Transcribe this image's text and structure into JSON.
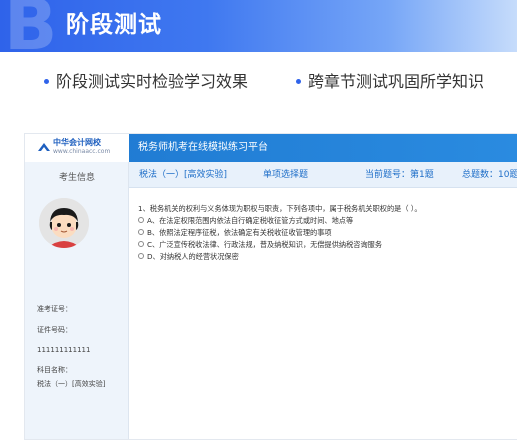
{
  "banner": {
    "letter": "B",
    "title": "阶段测试"
  },
  "features": [
    {
      "text": "阶段测试实时检验学习效果"
    },
    {
      "text": "跨章节测试巩固所学知识"
    }
  ],
  "app": {
    "logo": {
      "name_cn": "中华会计网校",
      "domain": "www.chinaacc.com"
    },
    "title": "税务师机考在线模拟练习平台",
    "sidebar": {
      "candidate_label": "考生信息",
      "exam_no_label": "准考证号：",
      "id_label": "证件号码：",
      "id_value": "111111111111",
      "subject_label": "科目名称：",
      "subject_value": "税法（一）[高效实验]"
    },
    "subheader": {
      "subject": "税法（一）[高效实验]",
      "question_type": "单项选择题",
      "current_label": "当前题号：第1题",
      "total_label": "总题数：10题"
    },
    "question": {
      "stem": "1、税务机关的权利与义务体现为职权与职责，下列各项中，属于税务机关职权的是（    ）。",
      "options": [
        "A、在法定权限范围内依法自行确定税收征管方式或时间、地点等",
        "B、依照法定程序征税，依法确定有关税收征收管理的事项",
        "C、广泛宣传税收法律、行政法规，普及纳税知识，无偿提供纳税咨询服务",
        "D、对纳税人的经营状况保密"
      ]
    }
  },
  "colors": {
    "banner_blue": "#2f63ea",
    "header_blue": "#1e78d0",
    "link_blue": "#1e6ec8"
  }
}
